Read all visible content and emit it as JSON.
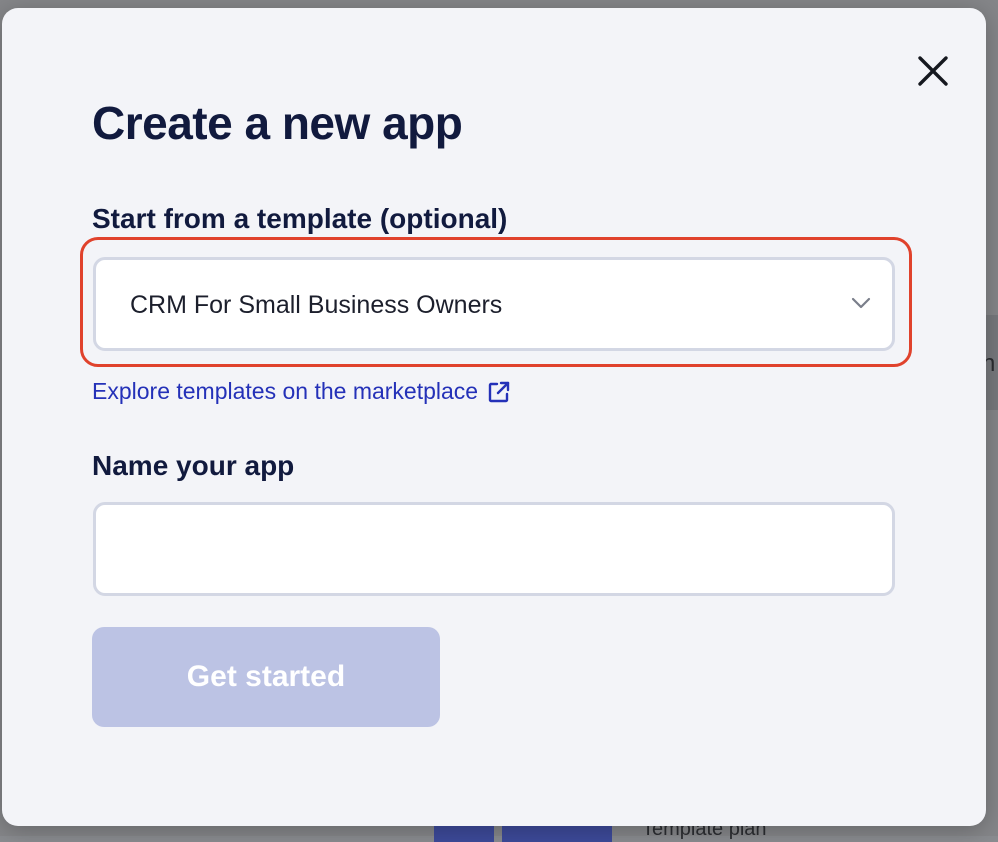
{
  "background": {
    "fragment_text": "n",
    "bottom_text": "Template plan"
  },
  "modal": {
    "title": "Create a new app",
    "close_icon": "close-icon",
    "template": {
      "label": "Start from a template (optional)",
      "selected_value": "CRM For Small Business Owners",
      "explore_link": "Explore templates on the marketplace"
    },
    "name": {
      "label": "Name your app",
      "value": "",
      "placeholder": ""
    },
    "submit_label": "Get started"
  },
  "colors": {
    "highlight": "#e0422c",
    "link": "#2431b8",
    "title": "#111a3e",
    "button_disabled": "#bcc3e4"
  }
}
